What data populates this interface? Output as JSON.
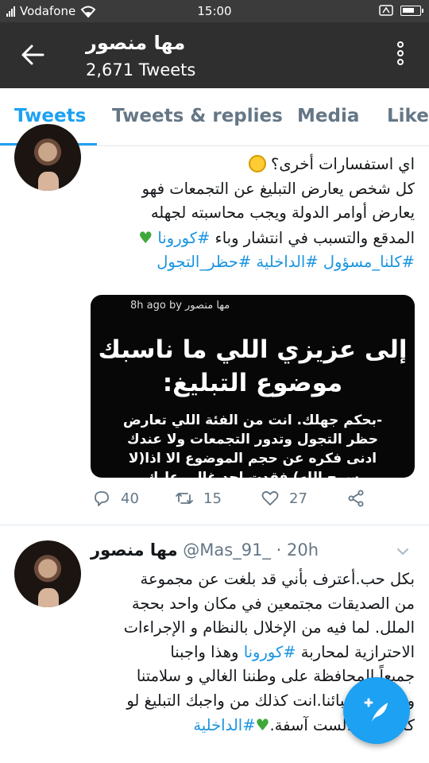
{
  "status_bar": {
    "carrier": "Vodafone",
    "time": "15:00"
  },
  "header": {
    "name": "مها منصور",
    "tweet_count": "2,671 Tweets"
  },
  "tabs": [
    {
      "label": "Tweets",
      "active": true
    },
    {
      "label": "Tweets & replies",
      "active": false
    },
    {
      "label": "Media",
      "active": false
    },
    {
      "label": "Likes",
      "active": false
    }
  ],
  "tweet1": {
    "line1": "اي استفسارات أخرى؟",
    "line2": "كل شخص يعارض التبليغ عن التجمعات فهو",
    "line3": "يعارض أوامر الدولة ويجب محاسبته لجهله",
    "line4": "المدقع والتسبب في انتشار وباء",
    "hashtag_corona": "#كورونا",
    "hashtag_all": "#كلنا_مسؤول",
    "hashtag_interior": "#الداخلية",
    "hashtag_curfew": "#حظر_التجول",
    "media": {
      "overlay_top": "8h ago by مها منصور",
      "heading_line1": "إلى عزيزي اللي ما ناسبك",
      "heading_line2": "موضوع التبليغ:",
      "body_line1": "-بحكم جهلك. انت من الفئة اللي تعارض",
      "body_line2": "حظر التجول وتدور التجمعات ولا عندك",
      "body_line3": "ادنى فكره عن حجم الموضوع الا اذا(لا",
      "body_line4": "سمح الله) فقدت احد غالي عليك"
    },
    "replies": "40",
    "retweets": "15",
    "likes": "27"
  },
  "tweet2": {
    "name": "مها منصور",
    "handle": "@Mas_91_",
    "time": "· 20h",
    "line1": "بكل حب.أعترف بأني قد بلغت عن مجموعة",
    "line2": "من الصديقات مجتمعين في مكان واحد بحجة",
    "line3": "الملل. لما فيه من الإخلال بالنظام و الإجراءات",
    "line4a": "الاحترازية لمحاربة",
    "hashtag_corona": "#كورونا",
    "line4b": "وهذا واجبنا",
    "line5": "جميعاً المحافظة على وطننا الغالي و سلامتنا",
    "line6": "و سلامة أحبائنا.انت كذلك من واجبك التبليغ لو",
    "line7": "كان أخوك.لست آسفة.",
    "hashtag_interior": "#الداخلية"
  },
  "colors": {
    "accent": "#1da1f2",
    "hashtag": "#1b95e0",
    "header_bg": "#2f2f2f"
  }
}
